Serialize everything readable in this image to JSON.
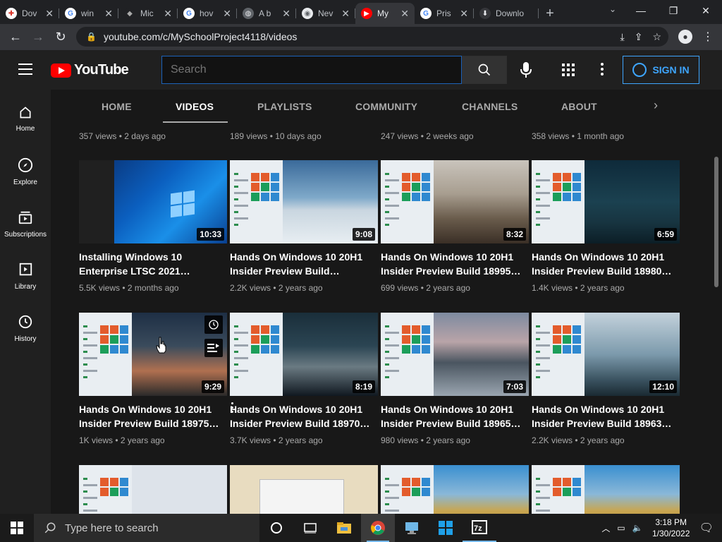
{
  "browser": {
    "tabs": [
      {
        "label": "Dov",
        "fav_color": "#ffffff",
        "fav_text": "✚",
        "fav_fg": "#d93025"
      },
      {
        "label": "win",
        "fav_color": "#ffffff",
        "fav_text": "G",
        "fav_fg": "#4285f4"
      },
      {
        "label": "Mic",
        "fav_color": "#202124",
        "fav_text": "◆",
        "fav_fg": "#aaaaaa"
      },
      {
        "label": "hov",
        "fav_color": "#ffffff",
        "fav_text": "G",
        "fav_fg": "#4285f4"
      },
      {
        "label": "A b",
        "fav_color": "#5f6368",
        "fav_text": "◍",
        "fav_fg": "#e8eaed"
      },
      {
        "label": "Nev",
        "fav_color": "#e8eaed",
        "fav_text": "◉",
        "fav_fg": "#5f6368"
      },
      {
        "label": "My",
        "fav_color": "#ff0000",
        "fav_text": "▶",
        "fav_fg": "#ffffff",
        "active": true
      },
      {
        "label": "Pris",
        "fav_color": "#ffffff",
        "fav_text": "G",
        "fav_fg": "#4285f4"
      },
      {
        "label": "Downlo",
        "fav_color": "#35363a",
        "fav_text": "⬇",
        "fav_fg": "#e8eaed"
      }
    ],
    "url": "youtube.com/c/MySchoolProject4118/videos"
  },
  "youtube": {
    "logo_text": "YouTube",
    "search_placeholder": "Search",
    "signin_label": "SIGN IN",
    "guide": [
      {
        "label": "Home",
        "icon": "home-icon"
      },
      {
        "label": "Explore",
        "icon": "compass-icon"
      },
      {
        "label": "Subscriptions",
        "icon": "subscriptions-icon"
      },
      {
        "label": "Library",
        "icon": "library-icon"
      },
      {
        "label": "History",
        "icon": "history-icon"
      }
    ],
    "channel_tabs": [
      "HOME",
      "VIDEOS",
      "PLAYLISTS",
      "COMMUNITY",
      "CHANNELS",
      "ABOUT"
    ],
    "active_tab": "VIDEOS",
    "top_row_meta": [
      "357 views • 2 days ago",
      "189 views • 10 days ago",
      "247 views • 2 weeks ago",
      "358 views • 1 month ago"
    ],
    "videos_row1": [
      {
        "title": "Installing Windows 10 Enterprise LTSC 2021…",
        "meta": "5.5K views • 2 months ago",
        "duration": "10:33",
        "bg": "win10"
      },
      {
        "title": "Hands On Windows 10 20H1 Insider Preview Build…",
        "meta": "2.2K views • 2 years ago",
        "duration": "9:08",
        "bg": "snowmountain"
      },
      {
        "title": "Hands On Windows 10 20H1 Insider Preview Build 18995…",
        "meta": "699 views • 2 years ago",
        "duration": "8:32",
        "bg": "rockpeak"
      },
      {
        "title": "Hands On Windows 10 20H1 Insider Preview Build 18980…",
        "meta": "1.4K views • 2 years ago",
        "duration": "6:59",
        "bg": "nightsky"
      }
    ],
    "videos_row2": [
      {
        "title": "Hands On Windows 10 20H1 Insider Preview Build 18975…",
        "meta": "1K views • 2 years ago",
        "duration": "9:29",
        "bg": "sunset"
      },
      {
        "title": "Hands On Windows 10 20H1 Insider Preview Build 18970…",
        "meta": "3.7K views • 2 years ago",
        "duration": "8:19",
        "bg": "darkpeak"
      },
      {
        "title": "Hands On Windows 10 20H1 Insider Preview Build 18965…",
        "meta": "980 views • 2 years ago",
        "duration": "7:03",
        "bg": "lake"
      },
      {
        "title": "Hands On Windows 10 20H1 Insider Preview Build 18963…",
        "meta": "2.2K views • 2 years ago",
        "duration": "12:10",
        "bg": "fog"
      }
    ]
  },
  "taskbar": {
    "search_placeholder": "Type here to search",
    "time": "3:18 PM",
    "date": "1/30/2022"
  }
}
